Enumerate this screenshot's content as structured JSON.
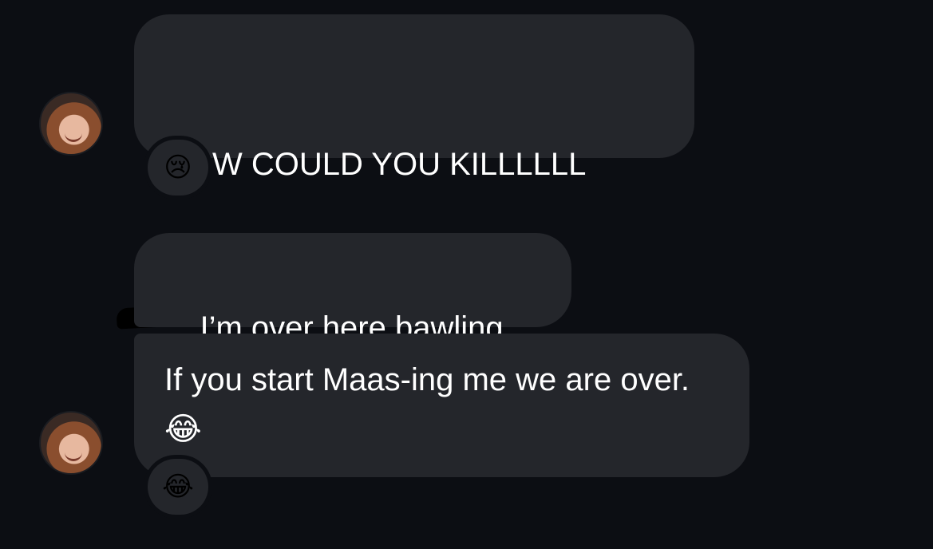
{
  "messages": [
    {
      "line1": "HOW COULD YOU KILLLLLL",
      "trailing_emoji": "😭",
      "redacted": true,
      "reaction": "😢"
    },
    {
      "text": "I’m over here bawling."
    },
    {
      "text": "If you start Maas-ing me we are over. ",
      "trailing_emoji": "😂",
      "reaction": "😂"
    }
  ],
  "colors": {
    "background": "#0c0e13",
    "bubble": "#24262b",
    "text": "#ffffff"
  }
}
